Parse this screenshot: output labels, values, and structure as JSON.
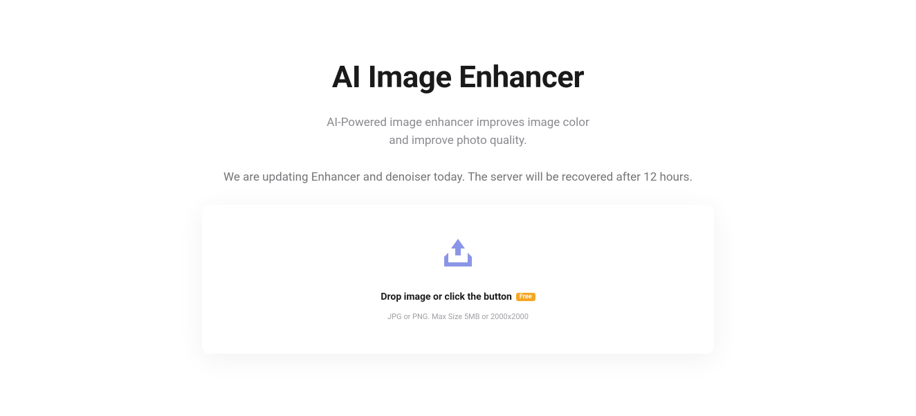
{
  "header": {
    "title": "AI Image Enhancer",
    "subtitle_line1": "AI-Powered image enhancer improves image color",
    "subtitle_line2": "and improve photo quality.",
    "notice": "We are updating Enhancer and denoiser today. The server will be recovered after 12 hours."
  },
  "upload": {
    "drop_text": "Drop image or click the button",
    "badge_label": "Free",
    "file_hint": "JPG or PNG. Max Size 5MB or 2000x2000"
  }
}
